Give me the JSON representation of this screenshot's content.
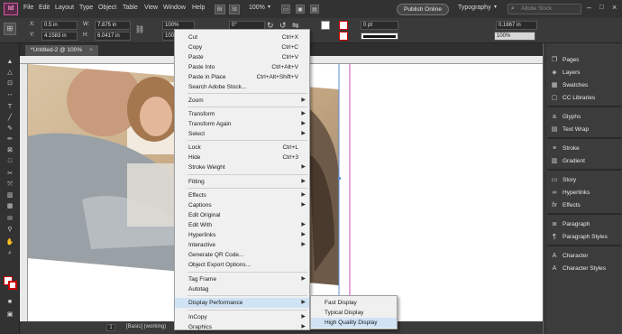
{
  "app": {
    "logo": "Id"
  },
  "menubar": {
    "items": [
      "File",
      "Edit",
      "Layout",
      "Type",
      "Object",
      "Table",
      "View",
      "Window",
      "Help"
    ],
    "badges": [
      "Br",
      "St"
    ],
    "zoom": "100%",
    "publish_label": "Publish Online",
    "workspace": "Typography",
    "search_placeholder": "Adobe Stock"
  },
  "control": {
    "x_label": "X:",
    "x_value": "0.5 in",
    "y_label": "Y:",
    "y_value": "4.1583 in",
    "w_label": "W:",
    "w_value": "7.875 in",
    "h_label": "H:",
    "h_value": "6.0417 in",
    "scale_x": "100%",
    "scale_y": "100%",
    "angle": "0°",
    "shear": "0°",
    "stroke_weight": "0 pt",
    "corner_value": "0.1667 in",
    "frame_scale": "100%"
  },
  "document": {
    "tab": "*Untitled-2 @ 100%"
  },
  "status": {
    "page": "1",
    "style": "[Basic] (working)"
  },
  "panels": {
    "groups": [
      [
        "Pages",
        "Layers",
        "Swatches",
        "CC Libraries"
      ],
      [
        "Glyphs",
        "Text Wrap"
      ],
      [
        "Stroke",
        "Gradient"
      ],
      [
        "Story",
        "Hyperlinks",
        "Effects"
      ],
      [
        "Paragraph",
        "Paragraph Styles"
      ],
      [
        "Character",
        "Character Styles"
      ]
    ]
  },
  "context_menu": {
    "items": [
      {
        "label": "Cut",
        "shortcut": "Ctrl+X"
      },
      {
        "label": "Copy",
        "shortcut": "Ctrl+C"
      },
      {
        "label": "Paste",
        "shortcut": "Ctrl+V"
      },
      {
        "label": "Paste Into",
        "shortcut": "Ctrl+Alt+V"
      },
      {
        "label": "Paste in Place",
        "shortcut": "Ctrl+Alt+Shift+V"
      },
      {
        "label": "Search Adobe Stock...",
        "shortcut": ""
      },
      {
        "label": "Zoom",
        "shortcut": "",
        "submenu": true
      },
      {
        "label": "Transform",
        "shortcut": "",
        "submenu": true
      },
      {
        "label": "Transform Again",
        "shortcut": "",
        "submenu": true
      },
      {
        "label": "Select",
        "shortcut": "",
        "submenu": true
      },
      {
        "label": "Lock",
        "shortcut": "Ctrl+L"
      },
      {
        "label": "Hide",
        "shortcut": "Ctrl+3"
      },
      {
        "label": "Stroke Weight",
        "shortcut": "",
        "submenu": true
      },
      {
        "label": "Fitting",
        "shortcut": "",
        "submenu": true
      },
      {
        "label": "Effects",
        "shortcut": "",
        "submenu": true
      },
      {
        "label": "Captions",
        "shortcut": "",
        "submenu": true
      },
      {
        "label": "Edit Original",
        "shortcut": ""
      },
      {
        "label": "Edit With",
        "shortcut": "",
        "submenu": true
      },
      {
        "label": "Hyperlinks",
        "shortcut": "",
        "submenu": true
      },
      {
        "label": "Interactive",
        "shortcut": "",
        "submenu": true
      },
      {
        "label": "Generate QR Code...",
        "shortcut": ""
      },
      {
        "label": "Object Export Options...",
        "shortcut": ""
      },
      {
        "label": "Tag Frame",
        "shortcut": "",
        "submenu": true
      },
      {
        "label": "Autotag",
        "shortcut": ""
      },
      {
        "label": "Display Performance",
        "shortcut": "",
        "submenu": true
      },
      {
        "label": "InCopy",
        "shortcut": "",
        "submenu": true
      },
      {
        "label": "Graphics",
        "shortcut": "",
        "submenu": true
      }
    ]
  },
  "display_submenu": {
    "items": [
      "Fast Display",
      "Typical Display",
      "High Quality Display"
    ]
  }
}
